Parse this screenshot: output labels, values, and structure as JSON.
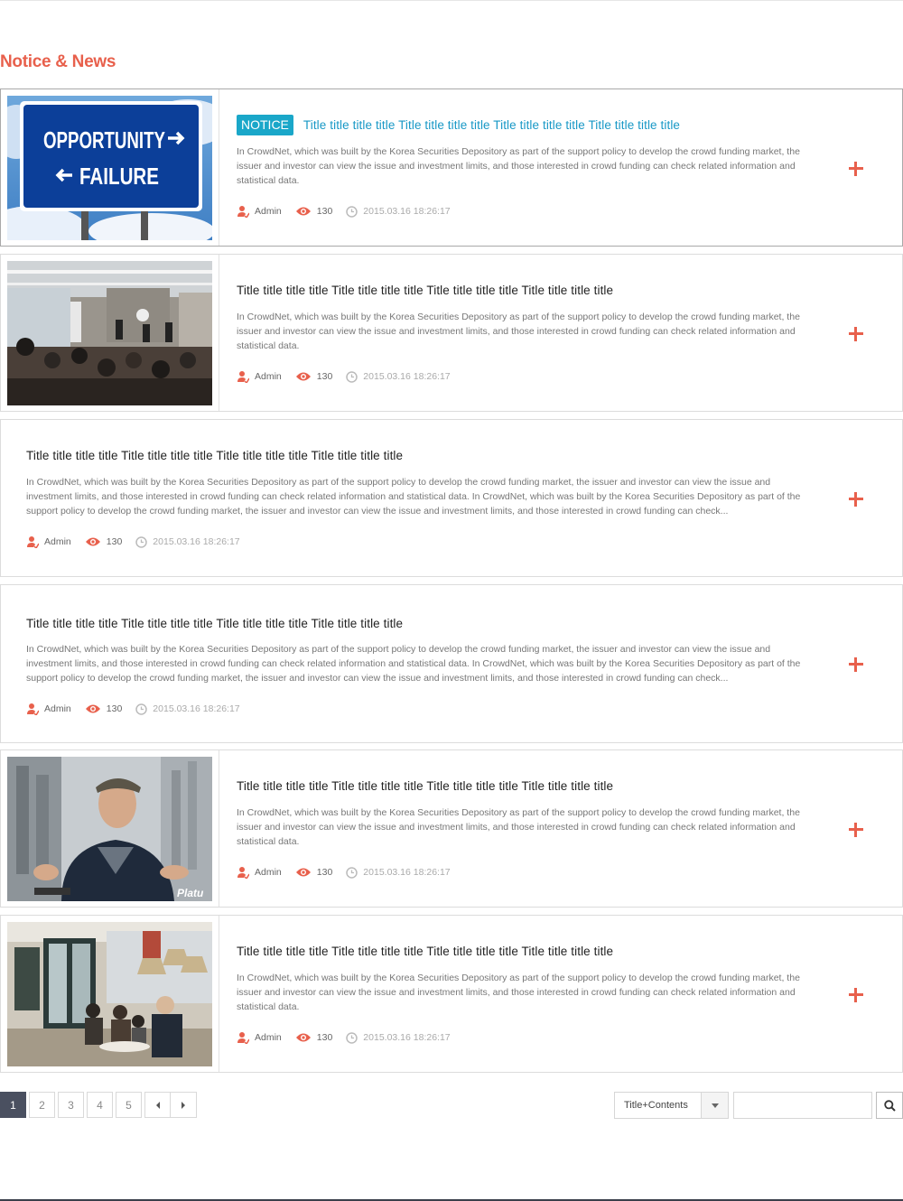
{
  "section": {
    "title": "Notice & News"
  },
  "posts": [
    {
      "badge": "NOTICE",
      "title": "Title title title title Title title title title Title title title title Title title title title",
      "description": "In CrowdNet, which was built by the Korea Securities Depository as part of the support policy to develop the crowd funding market, the issuer and investor can view the issue and investment limits, and those interested in crowd funding can check related information and statistical data.",
      "author": "Admin",
      "views": "130",
      "date": "2015.03.16 18:26:17",
      "image": "road-sign-photo"
    },
    {
      "title": "Title title title title Title title title title Title title title title Title title title title",
      "description": "In CrowdNet, which was built by the Korea Securities Depository as part of the support policy to develop the crowd funding market, the issuer and investor can view the issue and investment limits, and those interested in crowd funding can check related information and statistical data.",
      "author": "Admin",
      "views": "130",
      "date": "2015.03.16 18:26:17",
      "image": "conference-photo"
    },
    {
      "title": "Title title title title Title title title title Title title title title Title title title title",
      "description": "In CrowdNet, which was built by the Korea Securities Depository as part of the support policy to develop the crowd funding market, the issuer and investor can view the issue and investment limits, and those interested in crowd funding can check related information and statistical data. In CrowdNet, which was built by the Korea Securities Depository as part of the support policy to develop the crowd funding market, the issuer and investor can view the issue and investment limits, and those interested in crowd funding can check...",
      "author": "Admin",
      "views": "130",
      "date": "2015.03.16 18:26:17"
    },
    {
      "title": "Title title title title Title title title title Title title title title Title title title title",
      "description": "In CrowdNet, which was built by the Korea Securities Depository as part of the support policy to develop the crowd funding market, the issuer and investor can view the issue and investment limits, and those interested in crowd funding can check related information and statistical data. In CrowdNet, which was built by the Korea Securities Depository as part of the support policy to develop the crowd funding market, the issuer and investor can view the issue and investment limits, and those interested in crowd funding can check...",
      "author": "Admin",
      "views": "130",
      "date": "2015.03.16 18:26:17"
    },
    {
      "title": "Title title title title Title title title title Title title title title Title title title title",
      "description": "In CrowdNet, which was built by the Korea Securities Depository as part of the support policy to develop the crowd funding market, the issuer and investor can view the issue and investment limits, and those interested in crowd funding can check related information and statistical data.",
      "author": "Admin",
      "views": "130",
      "date": "2015.03.16 18:26:17",
      "image": "interview-photo"
    },
    {
      "title": "Title title title title Title title title title Title title title title Title title title title",
      "description": "In CrowdNet, which was built by the Korea Securities Depository as part of the support policy to develop the crowd funding market, the issuer and investor can view the issue and investment limits, and those interested in crowd funding can check related information and statistical data.",
      "author": "Admin",
      "views": "130",
      "date": "2015.03.16 18:26:17",
      "image": "cafe-meeting-photo"
    }
  ],
  "images": {
    "road_sign_line1": "OPPORTUNITY",
    "road_sign_line2": "FAILURE",
    "watermark": "Platu"
  },
  "pagination": {
    "pages": [
      "1",
      "2",
      "3",
      "4",
      "5"
    ],
    "current": "1",
    "prev_icon": "caret-left-icon",
    "next_icon": "caret-right-icon"
  },
  "search": {
    "filter_value": "Title+Contents",
    "query": "",
    "button_icon": "search-icon"
  },
  "colors": {
    "accent": "#e8604c",
    "notice": "#1aa7c9",
    "pager_active": "#4a5060"
  }
}
